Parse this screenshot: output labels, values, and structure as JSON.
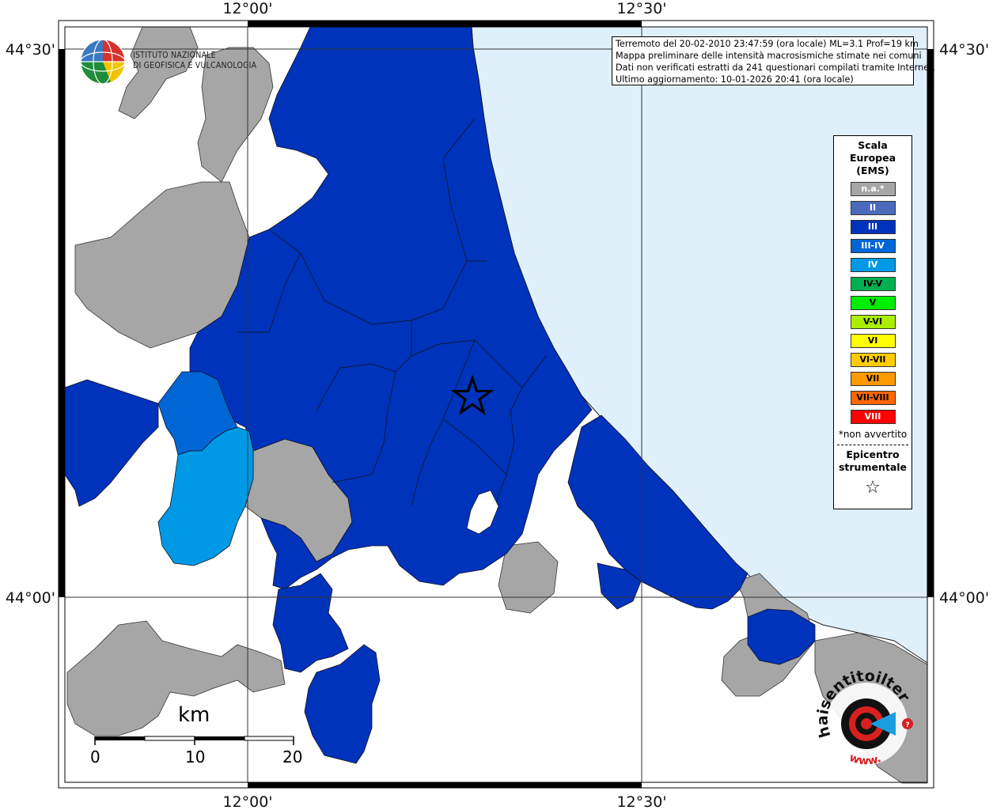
{
  "coordinates": {
    "lon_left": "12°00'",
    "lon_right": "12°30'",
    "lat_top": "44°30'",
    "lat_bottom": "44°00'"
  },
  "logo": {
    "line1": "ISTITUTO NAZIONALE",
    "line2": "DI GEOFISICA E VULCANOLOGIA"
  },
  "info": {
    "line1": "Terremoto del 20-02-2010 23:47:59 (ora locale) ML=3.1 Prof=19 km",
    "line2": "Mappa preliminare delle intensità macrosismiche stimate nei comuni",
    "line3": "Dati non verificati estratti da 241 questionari compilati tramite Internet.",
    "line4": "Ultimo aggiornamento: 10-01-2026 20:41 (ora locale)"
  },
  "legend": {
    "title1": "Scala",
    "title2": "Europea",
    "title3": "(EMS)",
    "items": [
      {
        "label": "n.a.*",
        "color": "#a6a6a6"
      },
      {
        "label": "II",
        "color": "#4a6bbd"
      },
      {
        "label": "III",
        "color": "#0033bb"
      },
      {
        "label": "III-IV",
        "color": "#0066d6"
      },
      {
        "label": "IV",
        "color": "#0099e6"
      },
      {
        "label": "IV-V",
        "color": "#00b050"
      },
      {
        "label": "V",
        "color": "#00ee00"
      },
      {
        "label": "V-VI",
        "color": "#aaee00"
      },
      {
        "label": "VI",
        "color": "#ffff00"
      },
      {
        "label": "VI-VII",
        "color": "#ffcc00"
      },
      {
        "label": "VII",
        "color": "#ff9900"
      },
      {
        "label": "VII-VIII",
        "color": "#ff6600"
      },
      {
        "label": "VIII",
        "color": "#ff0000"
      }
    ],
    "note": "*non avvertito",
    "epicenter1": "Epicentro",
    "epicenter2": "strumentale",
    "star": "☆"
  },
  "scale": {
    "title": "km",
    "labels": [
      "0",
      "10",
      "20"
    ]
  },
  "colors": {
    "sea": "#e0f0fb",
    "land": "#ffffff",
    "na": "#a6a6a6",
    "iii": "#0033bb",
    "iii_iv": "#0066d6",
    "iv": "#0099e6"
  },
  "watermark": {
    "text": "haisentitoilterremoto.it",
    "url_text": "www."
  }
}
